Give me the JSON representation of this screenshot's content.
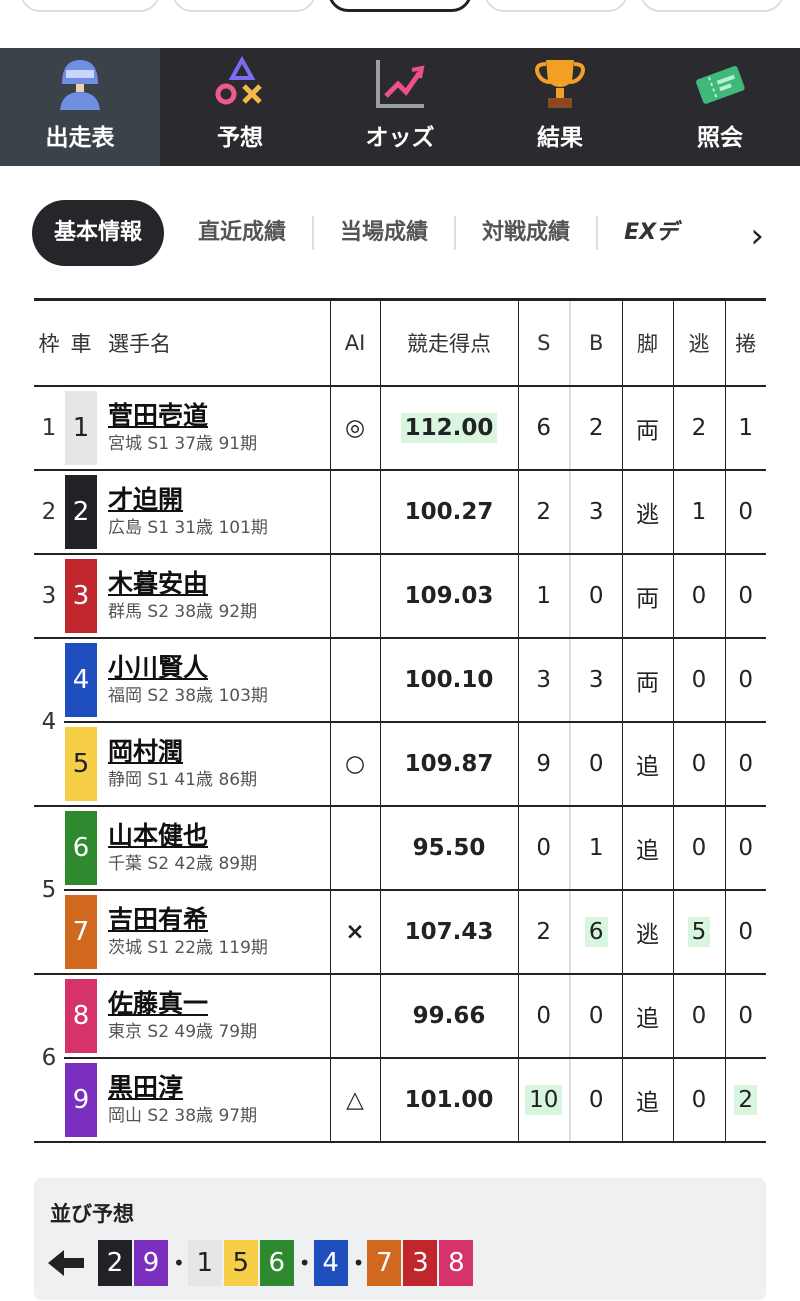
{
  "nav": [
    {
      "label": "出走表",
      "icon": "rider-helmet-icon",
      "active": true
    },
    {
      "label": "予想",
      "icon": "prediction-shapes-icon",
      "active": false
    },
    {
      "label": "オッズ",
      "icon": "odds-chart-icon",
      "active": false
    },
    {
      "label": "結果",
      "icon": "trophy-icon",
      "active": false
    },
    {
      "label": "照会",
      "icon": "ticket-icon",
      "active": false
    }
  ],
  "subtabs": [
    {
      "label": "基本情報",
      "active": true
    },
    {
      "label": "直近成績",
      "active": false
    },
    {
      "label": "当場成績",
      "active": false
    },
    {
      "label": "対戦成績",
      "active": false
    },
    {
      "label": "EXデ",
      "active": false
    }
  ],
  "table": {
    "headers": {
      "frame": "枠",
      "car": "車",
      "name": "選手名",
      "ai": "AI",
      "score": "競走得点",
      "s": "S",
      "b": "B",
      "style": "脚",
      "nige": "逃",
      "makuri": "捲"
    },
    "rows": [
      {
        "frame": "1",
        "car": "1",
        "name": "菅田壱道",
        "info": "宮城 S1 37歳 91期",
        "ai": "◎",
        "score": "112.00",
        "s": "6",
        "b": "2",
        "style": "両",
        "nige": "2",
        "makuri": "1"
      },
      {
        "frame": "2",
        "car": "2",
        "name": "才迫開",
        "info": "広島 S1 31歳 101期",
        "ai": "",
        "score": "100.27",
        "s": "2",
        "b": "3",
        "style": "逃",
        "nige": "1",
        "makuri": "0"
      },
      {
        "frame": "3",
        "car": "3",
        "name": "木暮安由",
        "info": "群馬 S2 38歳 92期",
        "ai": "",
        "score": "109.03",
        "s": "1",
        "b": "0",
        "style": "両",
        "nige": "0",
        "makuri": "0"
      },
      {
        "frame": "4",
        "car": "4",
        "name": "小川賢人",
        "info": "福岡 S2 38歳 103期",
        "ai": "",
        "score": "100.10",
        "s": "3",
        "b": "3",
        "style": "両",
        "nige": "0",
        "makuri": "0"
      },
      {
        "frame": "",
        "car": "5",
        "name": "岡村潤",
        "info": "静岡 S1 41歳 86期",
        "ai": "○",
        "score": "109.87",
        "s": "9",
        "b": "0",
        "style": "追",
        "nige": "0",
        "makuri": "0"
      },
      {
        "frame": "5",
        "car": "6",
        "name": "山本健也",
        "info": "千葉 S2 42歳 89期",
        "ai": "",
        "score": "95.50",
        "s": "0",
        "b": "1",
        "style": "追",
        "nige": "0",
        "makuri": "0"
      },
      {
        "frame": "",
        "car": "7",
        "name": "吉田有希",
        "info": "茨城 S1 22歳 119期",
        "ai": "×",
        "score": "107.43",
        "s": "2",
        "b": "6",
        "style": "逃",
        "nige": "5",
        "makuri": "0"
      },
      {
        "frame": "6",
        "car": "8",
        "name": "佐藤真一",
        "info": "東京 S2 49歳 79期",
        "ai": "",
        "score": "99.66",
        "s": "0",
        "b": "0",
        "style": "追",
        "nige": "0",
        "makuri": "0"
      },
      {
        "frame": "",
        "car": "9",
        "name": "黒田淳",
        "info": "岡山 S2 38歳 97期",
        "ai": "△",
        "score": "101.00",
        "s": "10",
        "b": "0",
        "style": "追",
        "nige": "0",
        "makuri": "2"
      }
    ]
  },
  "car_colors": {
    "1": {
      "bg": "#e6e6e6",
      "fg": "#222222"
    },
    "2": {
      "bg": "#222226",
      "fg": "#ffffff"
    },
    "3": {
      "bg": "#c0272d",
      "fg": "#ffffff"
    },
    "4": {
      "bg": "#1f4fbf",
      "fg": "#ffffff"
    },
    "5": {
      "bg": "#f6cf46",
      "fg": "#222222"
    },
    "6": {
      "bg": "#2f8a2f",
      "fg": "#ffffff"
    },
    "7": {
      "bg": "#d0681f",
      "fg": "#ffffff"
    },
    "8": {
      "bg": "#d6336c",
      "fg": "#ffffff"
    },
    "9": {
      "bg": "#7a2fbf",
      "fg": "#ffffff"
    }
  },
  "forecast": {
    "title": "並び予想",
    "groups": [
      [
        "2",
        "9"
      ],
      [
        "1",
        "5",
        "6"
      ],
      [
        "4"
      ],
      [
        "7",
        "3",
        "8"
      ]
    ]
  },
  "highlight_color": "#d8f5e0"
}
